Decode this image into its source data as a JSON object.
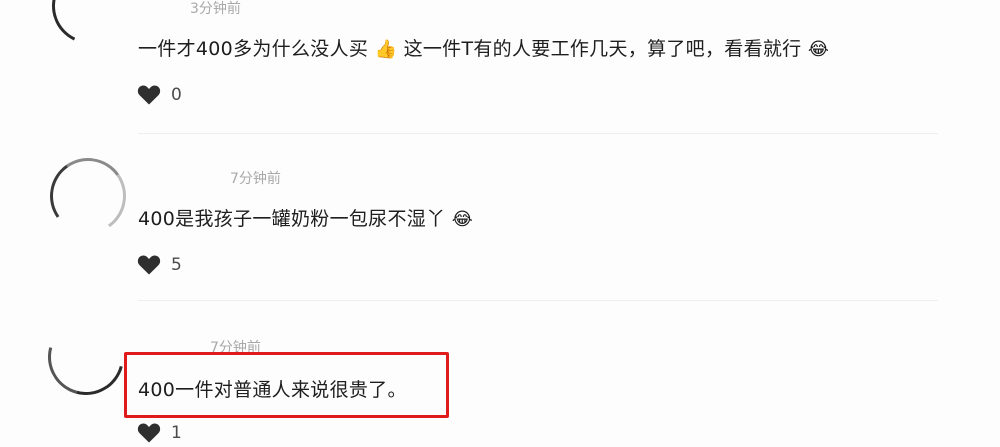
{
  "comments": [
    {
      "time": "3分钟前",
      "text": "一件才400多为什么没人买",
      "emoji1": "👍",
      "text2": "这一件T有的人要工作几天，算了吧，看看就行",
      "emoji2": "😂",
      "likes": "0"
    },
    {
      "time": "7分钟前",
      "text": "400是我孩子一罐奶粉一包尿不湿丫",
      "emoji1": "😂",
      "likes": "5"
    },
    {
      "time": "7分钟前",
      "text": "400一件对普通人来说很贵了。",
      "likes": "1"
    }
  ],
  "icons": {
    "like": "heart-icon"
  },
  "colors": {
    "highlight": "#e01b1b",
    "heart": "#2f2f2f"
  }
}
